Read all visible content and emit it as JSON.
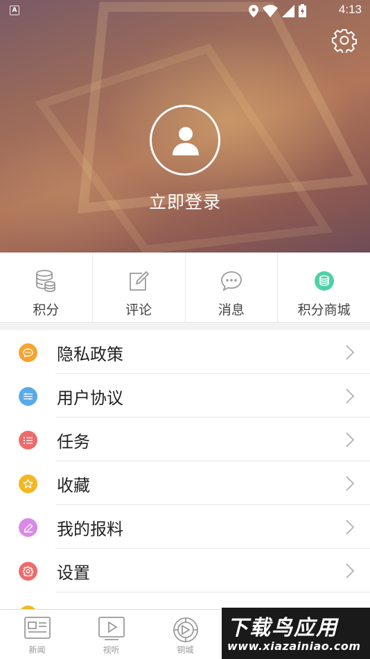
{
  "status_bar": {
    "app_indicator": "A",
    "time": "4:13",
    "icons": [
      "location-icon",
      "wifi-icon",
      "signal-icon",
      "battery-icon"
    ]
  },
  "header": {
    "settings_icon": "gear-icon",
    "avatar_icon": "user-icon",
    "login_label": "立即登录"
  },
  "quick_actions": [
    {
      "label": "积分",
      "icon": "database-icon",
      "color": "#9a9a9a"
    },
    {
      "label": "评论",
      "icon": "edit-icon",
      "color": "#9a9a9a"
    },
    {
      "label": "消息",
      "icon": "chat-bubble-icon",
      "color": "#9a9a9a"
    },
    {
      "label": "积分商城",
      "icon": "coin-stack-icon",
      "color": "#4fd1a5"
    }
  ],
  "menu": [
    {
      "label": "隐私政策",
      "icon": "chat-dots-icon",
      "color": "#f5a431"
    },
    {
      "label": "用户协议",
      "icon": "layers-icon",
      "color": "#5aa9e8"
    },
    {
      "label": "任务",
      "icon": "list-icon",
      "color": "#ef6b6b"
    },
    {
      "label": "收藏",
      "icon": "star-icon",
      "color": "#f2b722"
    },
    {
      "label": "我的报料",
      "icon": "pencil-icon",
      "color": "#d98ae6"
    },
    {
      "label": "设置",
      "icon": "settings-icon",
      "color": "#ef6b6b"
    }
  ],
  "bottom_nav": [
    {
      "label": "新闻",
      "icon": "newspaper-icon"
    },
    {
      "label": "视听",
      "icon": "play-icon"
    },
    {
      "label": "铜城",
      "icon": "city-emblem-icon"
    }
  ],
  "watermark": {
    "title": "下载鸟应用",
    "url": "www.xiazainiao.com"
  }
}
